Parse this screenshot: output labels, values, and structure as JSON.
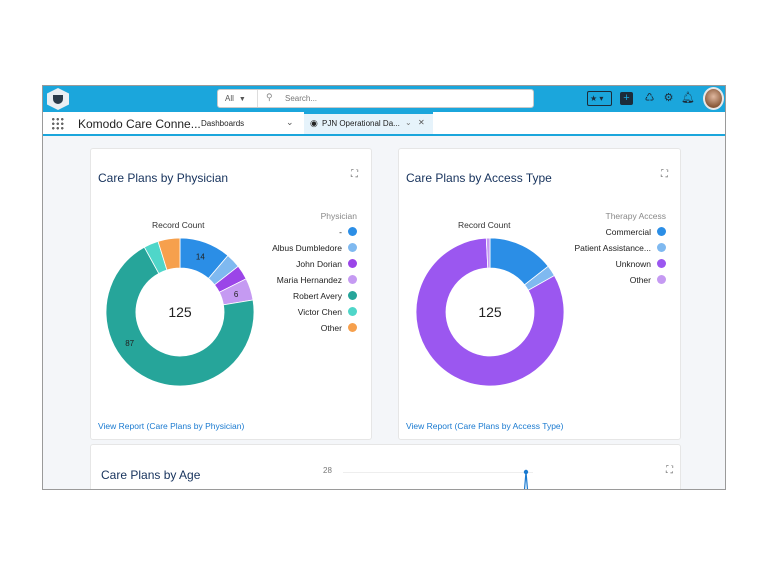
{
  "header": {
    "search_scope": "All",
    "search_placeholder": "Search..."
  },
  "nav": {
    "app_name": "Komodo Care Conne...",
    "object_menu": "Dashboards",
    "tab_label": "PJN Operational Da..."
  },
  "chart_data": [
    {
      "type": "pie",
      "title": "Care Plans by Physician",
      "subtitle": "Record Count",
      "center_total": "125",
      "legend_title": "Physician",
      "legend_position": "right",
      "categories": [
        "-",
        "Albus Dumbledore",
        "John Dorian",
        "Maria Hernandez",
        "Robert Avery",
        "Victor Chen",
        "Other"
      ],
      "values": [
        14,
        4,
        4,
        6,
        87,
        4,
        6
      ],
      "data_labels": [
        "14",
        "",
        "",
        "6",
        "87",
        "",
        ""
      ],
      "colors": [
        "#2b8ee6",
        "#7fb9f0",
        "#9b45e8",
        "#c59af2",
        "#26a59a",
        "#4fd6c9",
        "#f6a04d"
      ],
      "link": "View Report (Care Plans by Physician)"
    },
    {
      "type": "pie",
      "title": "Care Plans by Access Type",
      "subtitle": "Record Count",
      "center_total": "125",
      "legend_title": "Therapy Access",
      "legend_position": "right",
      "categories": [
        "Commercial",
        "Patient Assistance...",
        "Unknown",
        "Other"
      ],
      "values": [
        18,
        3,
        103,
        1
      ],
      "data_labels": [
        "",
        "",
        "",
        ""
      ],
      "colors": [
        "#2b8ee6",
        "#7fb9f0",
        "#9b57f0",
        "#c59af2"
      ],
      "link": "View Report (Care Plans by Access Type)"
    },
    {
      "type": "line",
      "title": "Care Plans by Age",
      "y_ticks": [
        "28"
      ]
    }
  ]
}
